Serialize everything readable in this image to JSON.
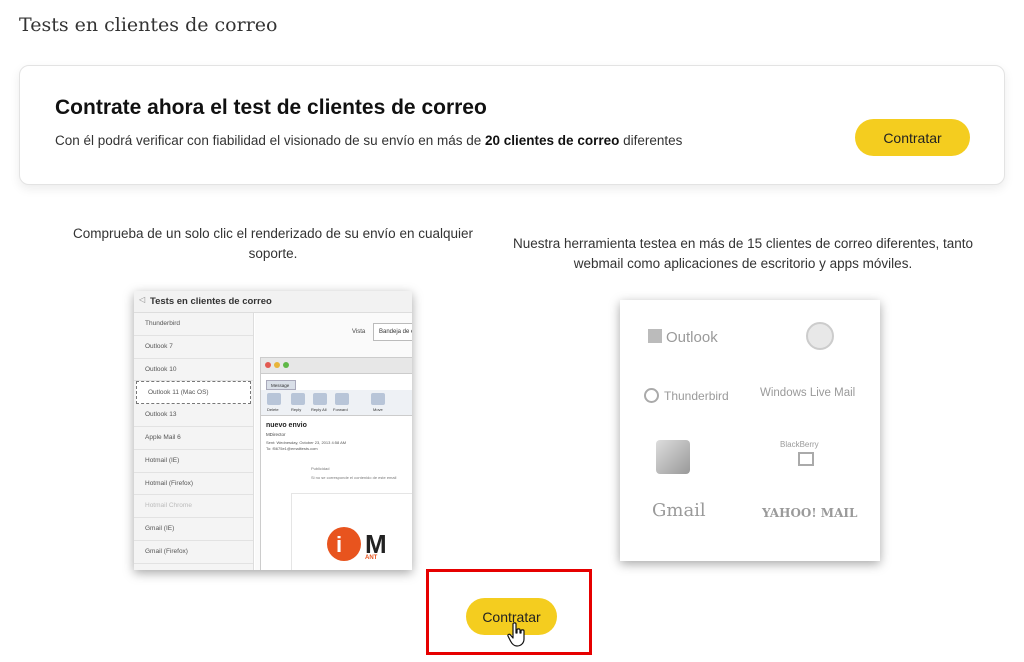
{
  "page": {
    "title": "Tests en clientes de correo"
  },
  "promo": {
    "heading": "Contrate ahora el test de clientes de correo",
    "text_prefix": "Con él podrá verificar con fiabilidad el visionado de su envío en más de ",
    "text_bold": "20 clientes de correo",
    "text_suffix": " diferentes",
    "button_label": "Contratar"
  },
  "captions": {
    "left": "Comprueba de un solo clic el renderizado de su envío en cualquier soporte.",
    "right": "Nuestra herramienta testea en más de 15 clientes de correo diferentes, tanto webmail como aplicaciones de escritorio y apps móviles."
  },
  "screenshot_left": {
    "header_title": "Tests en clientes de correo",
    "clients": [
      "Thunderbird",
      "Outlook 7",
      "Outlook 10",
      "Outlook 11 (Mac OS)",
      "Outlook 13",
      "Apple Mail 6",
      "Hotmail (IE)",
      "Hotmail (Firefox)",
      "Hotmail Chrome",
      "Gmail (IE)",
      "Gmail (Firefox)"
    ],
    "selected_index": 3,
    "muted_index": 8,
    "vista_label": "Vista",
    "vista_value": "Bandeja de entrada",
    "mail_tab": "Message",
    "actions": [
      "Delete",
      "Reply",
      "Reply All",
      "Forward",
      "Move"
    ],
    "mail_subject": "nuevo envio",
    "mail_from": "MDirector",
    "mail_sent": "Sent: Wednesday, October 23, 2013 4:58 AM",
    "mail_to": "To: f5675e1@emailtests.com",
    "mail_body_line1": "Publicidad",
    "mail_body_line2": "Si no se corresponde el contenido de este email",
    "brand_letter": "M",
    "brand_sub": "ANT"
  },
  "screenshot_right": {
    "logos": {
      "outlook": "Outlook",
      "thunderbird": "Thunderbird",
      "windows_live_mail": "Windows Live Mail",
      "blackberry": "BlackBerry",
      "gmail": "Gmail",
      "yahoo_mail": "YAHOO! MAIL"
    }
  },
  "bottom": {
    "button_label": "Contratar"
  },
  "colors": {
    "button_yellow": "#f4cd1f",
    "highlight_red": "#e60000"
  }
}
